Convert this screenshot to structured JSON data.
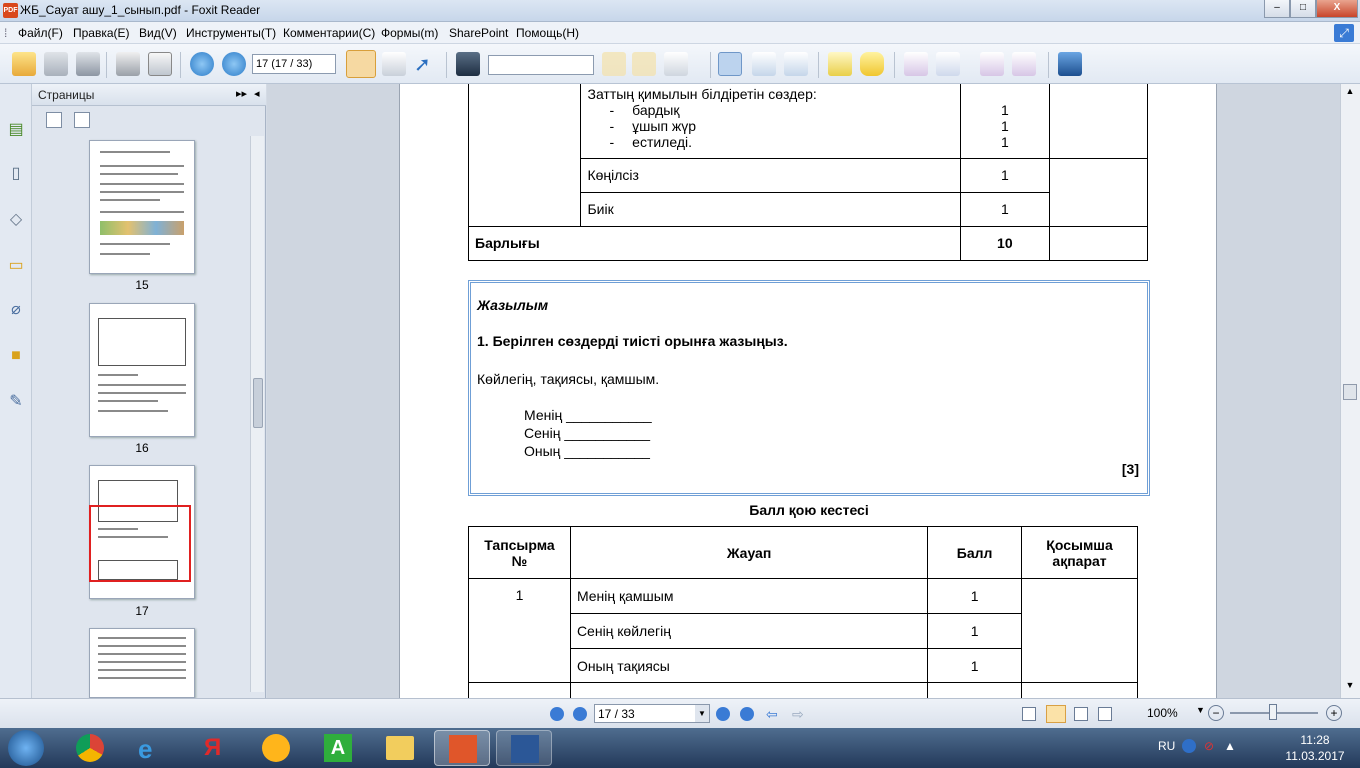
{
  "window": {
    "title": "ЖБ_Сауат ашу_1_сынып.pdf - Foxit Reader",
    "min": "–",
    "max": "□",
    "close": "X"
  },
  "menu": [
    "Файл(F)",
    "Правка(E)",
    "Вид(V)",
    "Инструменты(T)",
    "Комментарии(C)",
    "Формы(m)",
    "SharePoint",
    "Помощь(H)"
  ],
  "toolbar": {
    "page_value": "17 (17 / 33)",
    "search_value": ""
  },
  "thumbs": {
    "header": "Страницы",
    "pages": [
      "15",
      "16",
      "17"
    ]
  },
  "doc": {
    "top_table": {
      "heading": "Заттың қимылын білдіретін сөздер:",
      "items": [
        {
          "dash": "-",
          "text": "бардық",
          "score": "1"
        },
        {
          "dash": "-",
          "text": "ұшып жүр",
          "score": "1"
        },
        {
          "dash": "-",
          "text": "естиледі.",
          "score": "1"
        }
      ],
      "rows": [
        {
          "text": "Көңілсіз",
          "score": "1"
        },
        {
          "text": "Биік",
          "score": "1"
        }
      ],
      "total_label": "Барлығы",
      "total_value": "10"
    },
    "task": {
      "section": "Жазылым",
      "question": "1. Берілген сөздерді  тиісті орынға жазыңыз.",
      "words": "Көйлегің, тақиясы, қамшым.",
      "lines": [
        "Менің  ___________",
        "Сенің  ___________",
        "Оның  ___________"
      ],
      "points": "[3]"
    },
    "score_title": "Балл қою кестесі",
    "score_table": {
      "headers": [
        "Тапсырма №",
        "Жауап",
        "Балл",
        "Қосымша ақпарат"
      ],
      "task_no": "1",
      "rows": [
        {
          "answer": "Менің қамшым",
          "score": "1"
        },
        {
          "answer": "Сенің көйлегің",
          "score": "1"
        },
        {
          "answer": "Оның тақиясы",
          "score": "1"
        }
      ]
    }
  },
  "status": {
    "page": "17 / 33",
    "zoom": "100%"
  },
  "tray": {
    "lang": "RU",
    "time": "11:28",
    "date": "11.03.2017"
  }
}
